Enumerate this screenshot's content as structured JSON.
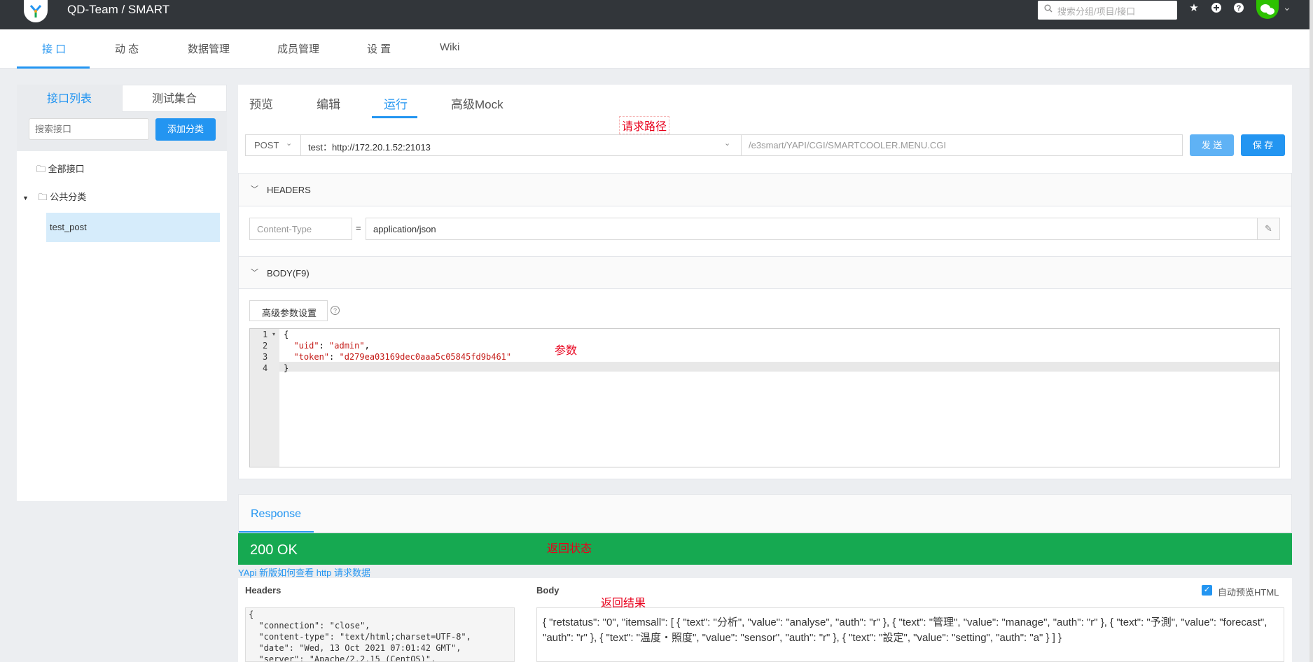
{
  "header": {
    "breadcrumb": "QD-Team / SMART",
    "search_placeholder": "搜索分组/项目/接口",
    "chevron": "⌄"
  },
  "nav": {
    "tabs": [
      {
        "label": "接 口"
      },
      {
        "label": "动 态"
      },
      {
        "label": "数据管理"
      },
      {
        "label": "成员管理"
      },
      {
        "label": "设 置"
      },
      {
        "label": "Wiki"
      }
    ]
  },
  "sidebar": {
    "tabs": [
      {
        "label": "接口列表"
      },
      {
        "label": "测试集合"
      }
    ],
    "search_placeholder": "搜索接口",
    "add_button": "添加分类",
    "tree": {
      "all": "全部接口",
      "category": "公共分类",
      "item": "test_post"
    }
  },
  "main": {
    "tabs": [
      {
        "label": "预览"
      },
      {
        "label": "编辑"
      },
      {
        "label": "运行"
      },
      {
        "label": "高级Mock"
      }
    ],
    "annotations": {
      "path": "请求路径",
      "params": "参数",
      "status": "返回状态",
      "result": "返回结果"
    },
    "request": {
      "method": "POST",
      "env": "test：http://172.20.1.52:21013",
      "path": "/e3smart/YAPI/CGI/SMARTCOOLER.MENU.CGI",
      "send": "发 送",
      "save": "保 存"
    },
    "headers_title": "HEADERS",
    "header_row": {
      "key": "Content-Type",
      "eq": "=",
      "value": "application/json"
    },
    "body_title": "BODY(F9)",
    "advanced_button": "高级参数设置",
    "code_lines": [
      {
        "n": "1",
        "text": "{"
      },
      {
        "n": "2",
        "key": "\"uid\"",
        "sep": ": ",
        "val": "\"admin\"",
        "end": ","
      },
      {
        "n": "3",
        "key": "\"token\"",
        "sep": ": ",
        "val": "\"d279ea03169dec0aaa5c05845fd9b461\"",
        "end": ""
      },
      {
        "n": "4",
        "text": "}"
      }
    ],
    "response": {
      "tab": "Response",
      "status": "200 OK",
      "help_link": "YApi 新版如何查看 http 请求数据",
      "headers_label": "Headers",
      "body_label": "Body",
      "auto_preview": "自动预览HTML",
      "headers_text": "{\n  \"connection\": \"close\",\n  \"content-type\": \"text/html;charset=UTF-8\",\n  \"date\": \"Wed, 13 Oct 2021 07:01:42 GMT\",\n  \"server\": \"Apache/2.2.15 (CentOS)\",",
      "body_text": "{ \"retstatus\": \"0\", \"itemsall\": [ { \"text\": \"分析\", \"value\": \"analyse\", \"auth\": \"r\" }, { \"text\": \"管理\", \"value\": \"manage\", \"auth\": \"r\" }, { \"text\": \"予測\", \"value\": \"forecast\", \"auth\": \"r\" }, { \"text\": \"温度・照度\", \"value\": \"sensor\", \"auth\": \"r\" }, { \"text\": \"設定\", \"value\": \"setting\", \"auth\": \"a\" } ] }"
    }
  },
  "colors": {
    "accent": "#2395f1",
    "ok": "#16a951",
    "annotation": "#e8001c"
  }
}
